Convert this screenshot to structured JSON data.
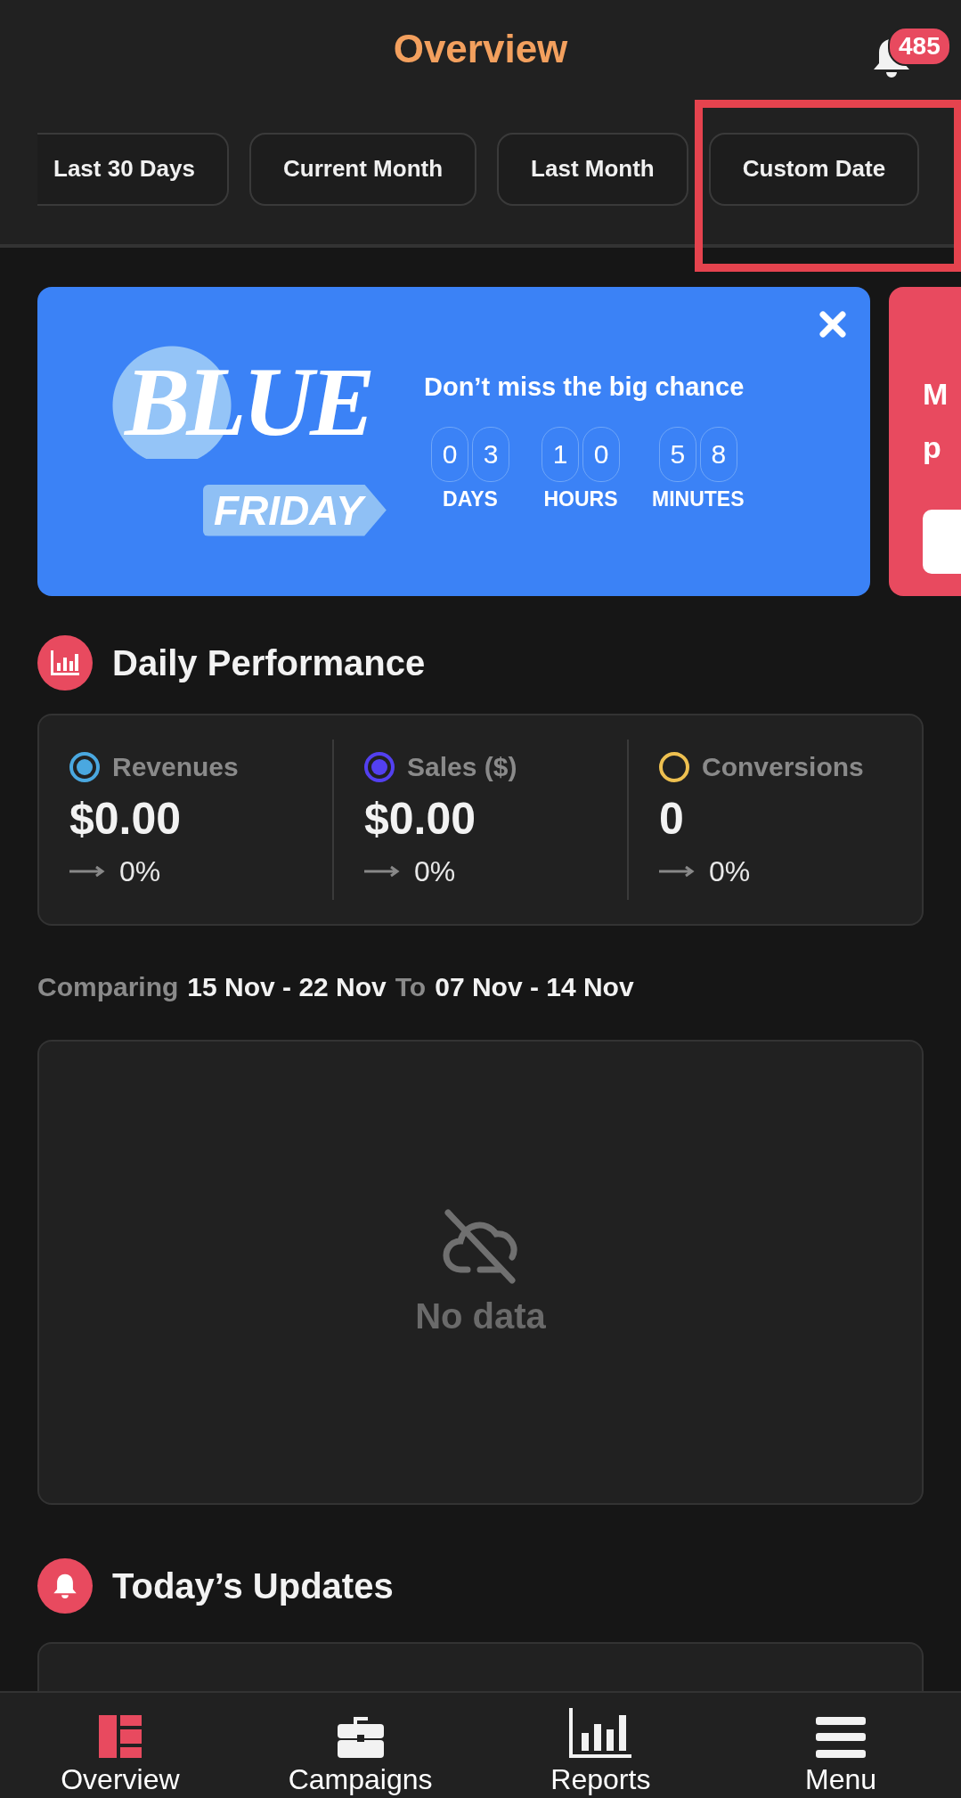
{
  "header": {
    "title": "Overview",
    "notification_count": "485"
  },
  "date_tabs": [
    {
      "label": "Last 30 Days",
      "selected": false
    },
    {
      "label": "Current Month",
      "selected": false
    },
    {
      "label": "Last Month",
      "selected": false
    },
    {
      "label": "Custom Date",
      "selected": false
    }
  ],
  "promo_banner": {
    "logo_word": "BLUE",
    "logo_tag": "FRIDAY",
    "headline": "Don’t miss the big chance",
    "countdown": [
      {
        "digits": [
          "0",
          "3"
        ],
        "unit": "DAYS"
      },
      {
        "digits": [
          "1",
          "0"
        ],
        "unit": "HOURS"
      },
      {
        "digits": [
          "5",
          "8"
        ],
        "unit": "MINUTES"
      }
    ]
  },
  "next_banner": {
    "lines": [
      "M",
      "p"
    ]
  },
  "daily_performance": {
    "title": "Daily Performance",
    "metrics": [
      {
        "label": "Revenues",
        "value": "$0.00",
        "change": "0%",
        "color": "#4aa8e0",
        "filled": true
      },
      {
        "label": "Sales ($)",
        "value": "$0.00",
        "change": "0%",
        "color": "#5340f0",
        "filled": true
      },
      {
        "label": "Conversions",
        "value": "0",
        "change": "0%",
        "color": "#eec050",
        "filled": false
      }
    ],
    "comparing": {
      "prefix": "Comparing",
      "current": "15 Nov - 22 Nov",
      "joiner": "To",
      "previous": "07 Nov - 14 Nov"
    },
    "empty_state": "No data"
  },
  "todays_updates": {
    "title": "Today’s Updates"
  },
  "bottom_nav": [
    {
      "label": "Overview",
      "selected": true,
      "kind": "dashboard"
    },
    {
      "label": "Campaigns",
      "selected": false,
      "kind": "briefcase"
    },
    {
      "label": "Reports",
      "selected": false,
      "kind": "chart"
    },
    {
      "label": "Menu",
      "selected": false,
      "kind": "menu"
    }
  ]
}
